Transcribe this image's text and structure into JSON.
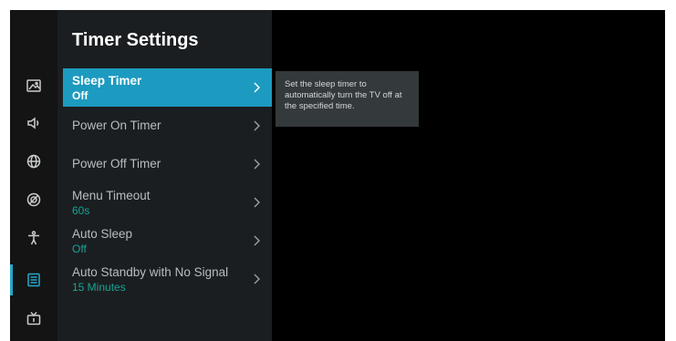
{
  "panel": {
    "title": "Timer Settings"
  },
  "rail": {
    "icons": [
      "picture-icon",
      "sound-icon",
      "network-icon",
      "general-icon",
      "accessibility-icon",
      "timer-settings-icon",
      "channel-icon"
    ]
  },
  "menu": {
    "items": [
      {
        "label": "Sleep Timer",
        "value": "Off"
      },
      {
        "label": "Power On Timer",
        "value": ""
      },
      {
        "label": "Power Off Timer",
        "value": ""
      },
      {
        "label": "Menu Timeout",
        "value": "60s"
      },
      {
        "label": "Auto Sleep",
        "value": "Off"
      },
      {
        "label": "Auto Standby with No Signal",
        "value": "15 Minutes"
      }
    ]
  },
  "tooltip": {
    "text": "Set the sleep timer to automatically turn the TV off at the specified time."
  },
  "colors": {
    "accent": "#1d9ac0",
    "value_text": "#15a596",
    "panel_bg": "#1b1e20",
    "rail_bg": "#141414"
  }
}
